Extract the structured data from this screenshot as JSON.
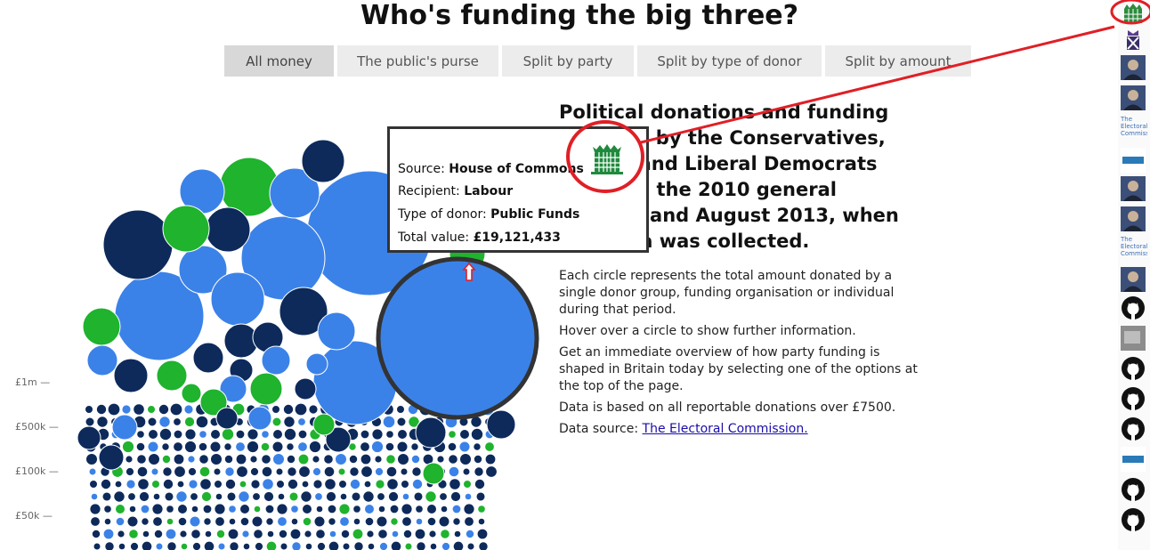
{
  "page": {
    "title": "Who's funding the big three?"
  },
  "nav": {
    "tabs": [
      {
        "label": "All money",
        "active": true
      },
      {
        "label": "The public's purse",
        "active": false
      },
      {
        "label": "Split by party",
        "active": false
      },
      {
        "label": "Split by type of donor",
        "active": false
      },
      {
        "label": "Split by amount",
        "active": false
      }
    ]
  },
  "scale": {
    "labels": [
      "£1m —",
      "£500k —",
      "£100k —",
      "£50k —"
    ]
  },
  "tooltip": {
    "source_label": "Source:",
    "source_value": "House of Commons",
    "recipient_label": "Recipient:",
    "recipient_value": "Labour",
    "type_label": "Type of donor:",
    "type_value": "Public Funds",
    "total_label": "Total value:",
    "total_value": "£19,121,433"
  },
  "intro": {
    "headline": "Political donations and funding received by the Conservatives, Labour and Liberal Democrats between the 2010 general election and August 2013, when this data was collected.",
    "paragraphs": [
      "Each circle represents the total amount donated by a single donor group, funding organisation or individual during that period.",
      "Hover over a circle to show further information.",
      "Get an immediate overview of how party funding is shaped in Britain today by selecting one of the options at the top of the page.",
      "Data is based on all reportable donations over £7500."
    ],
    "source_prefix": "Data source:",
    "source_link": "The Electoral Commission."
  },
  "rail": {
    "icons": [
      "portcullis-icon",
      "crest-icon",
      "portrait-icon",
      "portrait-icon",
      "electoral-commission-logo",
      "logo-icon",
      "portrait-icon",
      "portrait-icon",
      "electoral-commission-logo",
      "portrait-icon",
      "github-icon",
      "image-icon",
      "github-icon",
      "github-icon",
      "github-icon",
      "logo-icon",
      "github-icon",
      "github-icon"
    ]
  },
  "rail_text": {
    "ec": "The Electoral Commission"
  },
  "colors": {
    "conservative": "#0d2a5b",
    "labour": "#3b82e8",
    "libdem": "#1fb32e",
    "highlight": "#e01f26"
  }
}
